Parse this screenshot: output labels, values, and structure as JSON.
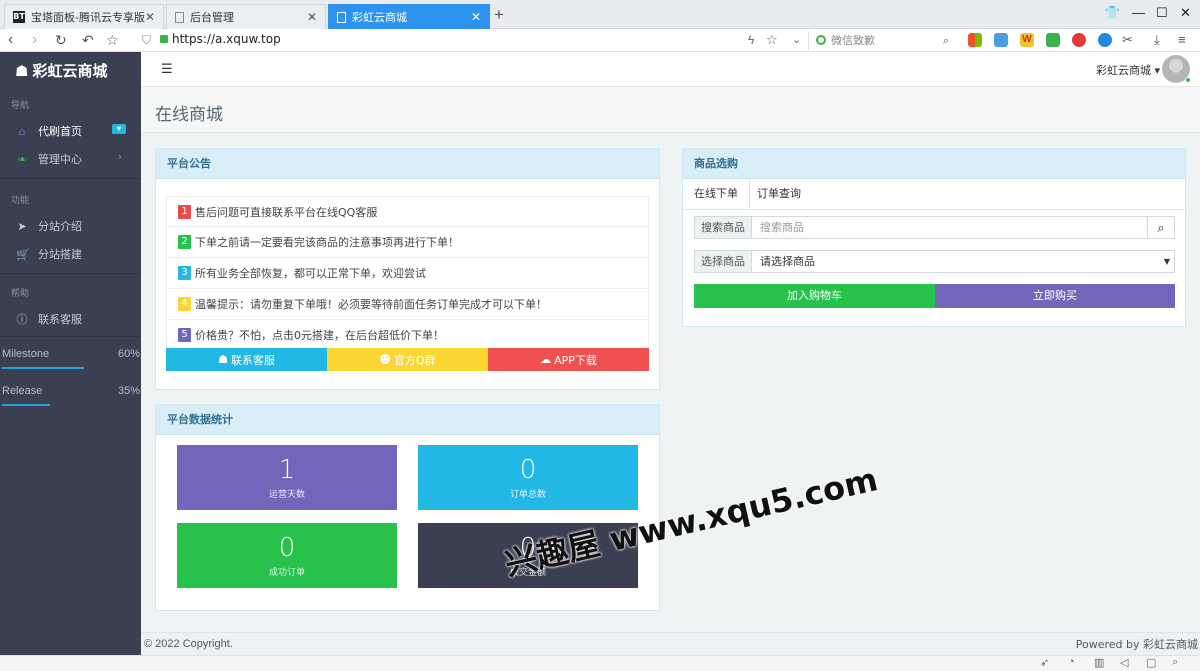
{
  "browser": {
    "tabs": [
      {
        "label": "宝塔面板-腾讯云专享版",
        "icon": "bt-icon"
      },
      {
        "label": "后台管理",
        "icon": "page-icon"
      },
      {
        "label": "彩虹云商城",
        "icon": "page-icon"
      }
    ],
    "close_glyph": "✕",
    "new_tab_glyph": "+",
    "url": "https://a.xquw.top",
    "search_placeholder": "微信致歉"
  },
  "app": {
    "brand": "彩虹云商城",
    "user_name": "彩虹云商城",
    "page_title": "在线商城",
    "colors": {
      "sidebar": "#3a3f51",
      "accent": "#23b7e5"
    }
  },
  "sidebar": {
    "sec_nav": "导航",
    "sec_func": "功能",
    "sec_help": "帮助",
    "items": [
      {
        "label": "代刷首页",
        "icon": "home-icon"
      },
      {
        "label": "管理中心",
        "icon": "leaf-icon"
      },
      {
        "label": "分站介绍",
        "icon": "send-icon"
      },
      {
        "label": "分站搭建",
        "icon": "cart-icon"
      },
      {
        "label": "联系客服",
        "icon": "info-icon"
      }
    ],
    "progress": [
      {
        "label": "Milestone",
        "value": "60%",
        "fraction": 0.6
      },
      {
        "label": "Release",
        "value": "35%",
        "fraction": 0.35
      }
    ]
  },
  "notice": {
    "title": "平台公告",
    "items": [
      {
        "num": "1",
        "text": "售后问题可直接联系平台在线QQ客服",
        "color": "#e84c4c"
      },
      {
        "num": "2",
        "text": "下单之前请一定要看完该商品的注意事项再进行下单！",
        "color": "#27c24c"
      },
      {
        "num": "3",
        "text": "所有业务全部恢复，都可以正常下单，欢迎尝试",
        "color": "#23b7e5"
      },
      {
        "num": "4",
        "text": "温馨提示：请勿重复下单哦！必须要等待前面任务订单完成才可以下单！",
        "color": "#fad733"
      },
      {
        "num": "5",
        "text": "价格贵？不怕，点击0元搭建，在后台超低价下单！",
        "color": "#7266ba"
      }
    ],
    "buttons": [
      {
        "label": "联系客服",
        "icon": "qq-icon",
        "color": "#23b7e5"
      },
      {
        "label": "官方Q群",
        "icon": "group-icon",
        "color": "#fad733"
      },
      {
        "label": "APP下载",
        "icon": "cloud-download-icon",
        "color": "#f05050"
      }
    ]
  },
  "stats": {
    "title": "平台数据统计",
    "cards": [
      {
        "value": "1",
        "label": "运营天数",
        "color": "#7266ba"
      },
      {
        "value": "0",
        "label": "订单总数",
        "color": "#23b7e5"
      },
      {
        "value": "0",
        "label": "成功订单",
        "color": "#27c24c"
      },
      {
        "value": "0",
        "label": "成交金额",
        "color": "#3a3f51"
      }
    ]
  },
  "shop": {
    "title": "商品选购",
    "tabs": [
      "在线下单",
      "订单查询"
    ],
    "search_label": "搜索商品",
    "search_placeholder": "搜索商品",
    "select_label": "选择商品",
    "select_value": "请选择商品",
    "add_cart": "加入购物车",
    "buy_now": "立即购买"
  },
  "footer": {
    "copyright": "© 2022 Copyright.",
    "powered": "Powered by 彩虹云商城"
  },
  "watermark": "兴趣屋 www.xqu5.com"
}
